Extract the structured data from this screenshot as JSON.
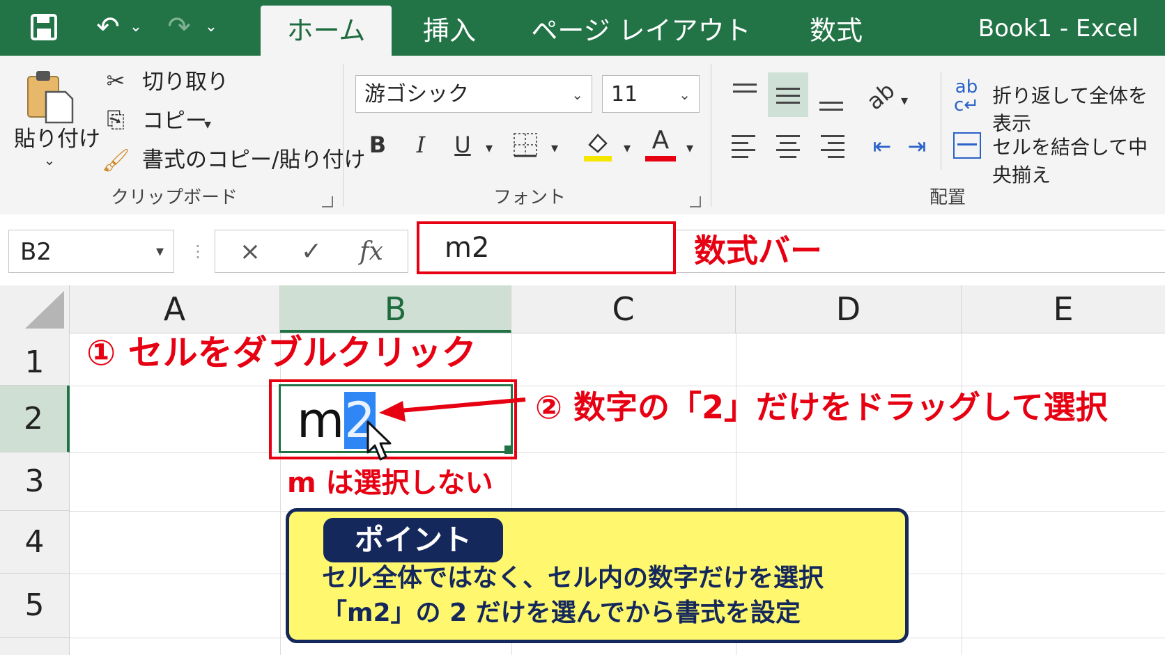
{
  "titlebar": {
    "tabs": [
      "ホーム",
      "挿入",
      "ページ レイアウト",
      "数式"
    ],
    "window_title": "Book1 - Excel"
  },
  "ribbon": {
    "clipboard": {
      "paste_label": "貼り付け",
      "cut_label": "切り取り",
      "copy_label": "コピー",
      "format_painter_label": "書式のコピー/貼り付け",
      "group_label": "クリップボード"
    },
    "font": {
      "font_name": "游ゴシック",
      "font_size": "11",
      "bold": "B",
      "italic": "I",
      "underline": "U",
      "font_color_glyph": "A",
      "group_label": "フォント"
    },
    "alignment": {
      "wrap_text_label": "折り返して全体を表示",
      "merge_center_label": "セルを結合して中央揃え",
      "group_label": "配置"
    }
  },
  "formula_bar": {
    "name_box": "B2",
    "cancel_glyph": "×",
    "enter_glyph": "✓",
    "fx_glyph": "fx",
    "content": "m2",
    "callout_label": "数式バー"
  },
  "grid": {
    "columns": [
      "A",
      "B",
      "C",
      "D",
      "E"
    ],
    "rows": [
      "1",
      "2",
      "3",
      "4",
      "5"
    ],
    "active_cell": {
      "text_plain": "m",
      "text_selected": "2"
    }
  },
  "annotations": {
    "step1": "① セルをダブルクリック",
    "step2": "② 数字の「2」だけをドラッグして選択",
    "note_m": "m は選択しない"
  },
  "point": {
    "badge": "ポイント",
    "line1": "セル全体ではなく、セル内の数字だけを選択",
    "line2": "「m2」の 2 だけを選んでから書式を設定"
  },
  "colors": {
    "excel_green": "#227447",
    "annotation_red": "#e60012",
    "point_yellow": "#fff86e",
    "point_navy": "#14285c",
    "selection_blue": "#2f86f5"
  }
}
